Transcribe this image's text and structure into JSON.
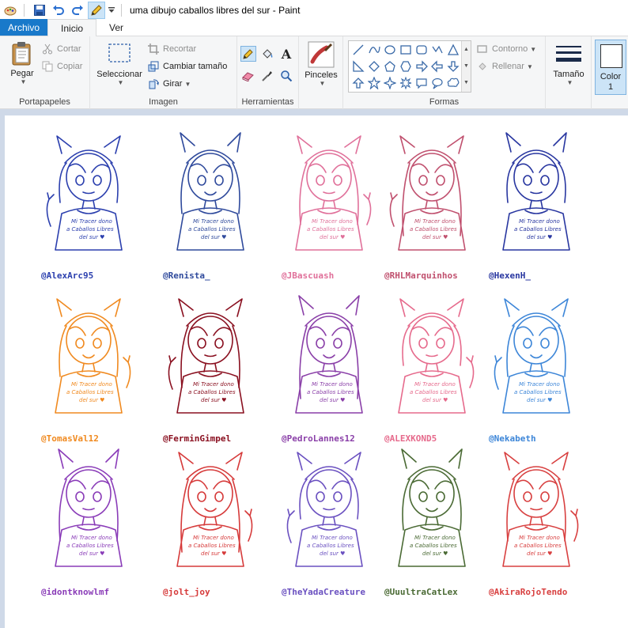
{
  "window": {
    "title": "uma dibujo caballos libres del sur - Paint"
  },
  "tabs": [
    {
      "label": "Archivo"
    },
    {
      "label": "Inicio"
    },
    {
      "label": "Ver"
    }
  ],
  "ribbon": {
    "clipboard": {
      "group_label": "Portapapeles",
      "paste_label": "Pegar",
      "cut_label": "Cortar",
      "copy_label": "Copiar"
    },
    "image": {
      "group_label": "Imagen",
      "select_label": "Seleccionar",
      "crop_label": "Recortar",
      "resize_label": "Cambiar tamaño",
      "rotate_label": "Girar"
    },
    "tools": {
      "group_label": "Herramientas"
    },
    "brushes": {
      "label": "Pinceles"
    },
    "shapes": {
      "group_label": "Formas",
      "outline_label": "Contorno",
      "fill_label": "Rellenar"
    },
    "size": {
      "label": "Tamaño"
    },
    "color1": {
      "label": "Color",
      "sublabel": "1"
    }
  },
  "canvas": {
    "shirt_text": [
      "Mi Tracer dono",
      "a Caballos Libres",
      "del sur"
    ],
    "artists": [
      {
        "handle": "@AlexArc95",
        "color": "#2b3fae"
      },
      {
        "handle": "@Renista_",
        "color": "#2f4a9c"
      },
      {
        "handle": "@JBascuash",
        "color": "#e0709a"
      },
      {
        "handle": "@RHLMarquinhos",
        "color": "#c0506e"
      },
      {
        "handle": "@HexenH_",
        "color": "#2836a0"
      },
      {
        "handle": "@TomasVal12",
        "color": "#f08a20"
      },
      {
        "handle": "@FerminGimpel",
        "color": "#8a1020"
      },
      {
        "handle": "@PedroLannes12",
        "color": "#8a3fa8"
      },
      {
        "handle": "@ALEXKOND5",
        "color": "#e66a8c"
      },
      {
        "handle": "@Nekabeth",
        "color": "#3d86d8"
      },
      {
        "handle": "@idontknowlmf",
        "color": "#8a3cb8"
      },
      {
        "handle": "@jolt_joy",
        "color": "#d63a3a"
      },
      {
        "handle": "@TheYadaCreature",
        "color": "#6a50c0"
      },
      {
        "handle": "@UuultraCatLex",
        "color": "#4a6a34"
      },
      {
        "handle": "@AkiraRojoTendo",
        "color": "#d84040"
      }
    ]
  }
}
